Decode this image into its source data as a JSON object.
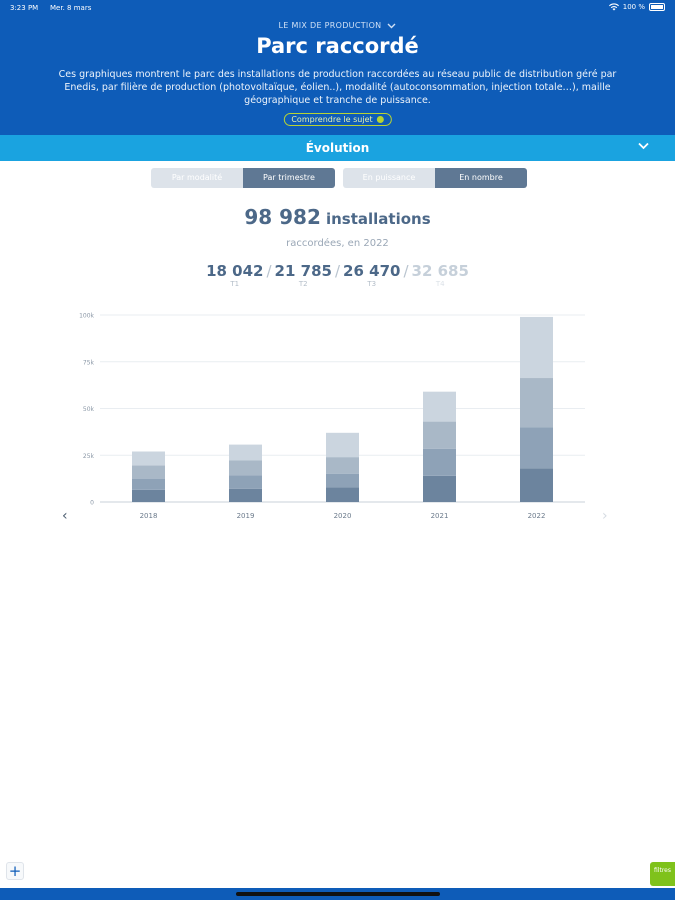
{
  "status_bar": {
    "time": "3:23 PM",
    "date": "Mer. 8 mars",
    "battery": "100 %"
  },
  "header": {
    "eyebrow": "LE MIX DE PRODUCTION",
    "title": "Parc raccordé",
    "description": "Ces graphiques montrent le parc des installations de production raccordées au réseau public de distribution géré par Enedis, par filière de production (photovoltaïque, éolien..), modalité (autoconsommation, injection totale…), maille géographique et tranche de puissance.",
    "cta_label": "Comprendre le sujet"
  },
  "section": {
    "title": "Évolution"
  },
  "toggles": {
    "group1": [
      {
        "label": "Par modalité",
        "active": false
      },
      {
        "label": "Par trimestre",
        "active": true
      }
    ],
    "group2": [
      {
        "label": "En puissance",
        "active": false
      },
      {
        "label": "En nombre",
        "active": true
      }
    ]
  },
  "summary": {
    "total": "98 982",
    "unit": "installations",
    "subtitle": "raccordées, en 2022",
    "quarters": [
      {
        "value": "18 042",
        "label": "T1"
      },
      {
        "value": "21 785",
        "label": "T2"
      },
      {
        "value": "26 470",
        "label": "T3"
      },
      {
        "value": "32 685",
        "label": "T4"
      }
    ]
  },
  "chart_data": {
    "type": "bar",
    "stacked": true,
    "categories": [
      "2018",
      "2019",
      "2020",
      "2021",
      "2022"
    ],
    "series": [
      {
        "name": "T1",
        "values": [
          6500,
          7000,
          7800,
          14000,
          18042
        ]
      },
      {
        "name": "T2",
        "values": [
          6000,
          7200,
          7200,
          14500,
          21785
        ]
      },
      {
        "name": "T3",
        "values": [
          7000,
          8000,
          9000,
          14500,
          26470
        ]
      },
      {
        "name": "T4",
        "values": [
          7500,
          8500,
          13000,
          16000,
          32685
        ]
      }
    ],
    "series_colors": [
      "#6c849e",
      "#8ea2b7",
      "#a9b8c7",
      "#cbd5df"
    ],
    "y_ticks": [
      "0",
      "25k",
      "50k",
      "75k",
      "100k"
    ],
    "ylim": [
      0,
      100000
    ],
    "grid": true
  },
  "footer": {
    "add_label": "+",
    "filters_label": "filtres"
  }
}
